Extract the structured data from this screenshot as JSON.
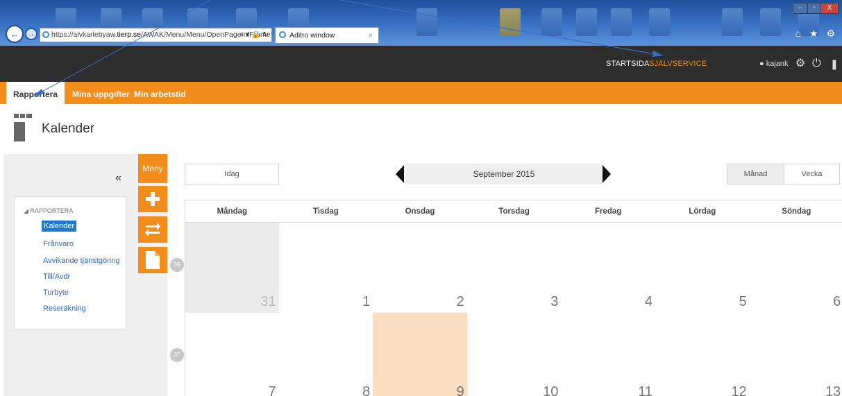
{
  "browser": {
    "url_host": "https://alvkarlebyaw.",
    "url_domain": "tierp.se",
    "url_path": "/AWAK/Menu/Menu/OpenPageInIFrame?",
    "url_controls": "⌕ ▾ 🔒 ↻",
    "tab_title": "Aditro window",
    "tab_close": "×",
    "right_icons": "⌂ ★ ⚙",
    "window_controls": [
      "–",
      "▫",
      "X"
    ]
  },
  "header": {
    "nav": [
      {
        "label": "STARTSIDA",
        "color": "#ffffff"
      },
      {
        "label": "SJÄLVSERVICE",
        "color": "#f28c1a"
      }
    ],
    "user": "kajank",
    "user_icon": "user-icon",
    "icons": [
      "gear-icon",
      "power-icon",
      "pin-icon"
    ]
  },
  "tabs": [
    {
      "label": "Rapportera",
      "active": true
    },
    {
      "label": "Mina uppgifter",
      "active": false
    },
    {
      "label": "Min arbetstid",
      "active": false
    }
  ],
  "page": {
    "title": "Kalender"
  },
  "sidebar": {
    "collapse": "«",
    "section": "◢ RAPPORTERA",
    "items": [
      {
        "label": "Kalender",
        "active": true
      },
      {
        "label": "Frånvaro"
      },
      {
        "label": "Avvikande tjänstgöring"
      },
      {
        "label": "Till/Avdr"
      },
      {
        "label": "Turbyte"
      },
      {
        "label": "Reseräkning"
      }
    ]
  },
  "menu": {
    "label": "Meny",
    "buttons": [
      "plus-icon",
      "swap-icon",
      "document-icon"
    ]
  },
  "calendar": {
    "today_button": "Idag",
    "month": "September 2015",
    "views": [
      "Månad",
      "Vecka"
    ],
    "active_view": "Månad",
    "days": [
      "Måndag",
      "Tisdag",
      "Onsdag",
      "Torsdag",
      "Fredag",
      "Lördag",
      "Söndag"
    ],
    "weeks": [
      {
        "week": "36",
        "dates": [
          "31",
          "1",
          "2",
          "3",
          "4",
          "5",
          "6"
        ]
      },
      {
        "week": "37",
        "dates": [
          "7",
          "8",
          "9",
          "10",
          "11",
          "12",
          "13"
        ]
      }
    ],
    "other_month_date": "31",
    "today_date": "9",
    "colors": {
      "accent": "#f28c1a",
      "today": "#fbdfc0",
      "link": "#2d6bbd"
    }
  }
}
